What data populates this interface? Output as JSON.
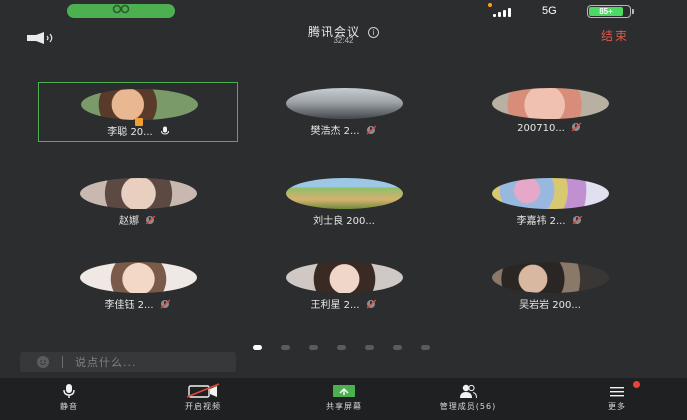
{
  "status_bar": {
    "network": "5G",
    "battery": "85+",
    "battery_level": 0.85
  },
  "header": {
    "title": "腾讯会议",
    "timer": "32:42",
    "end_label": "结束",
    "info_icon": "i"
  },
  "participants": [
    {
      "name": "李聪 20...",
      "mic_icon": "mic-icon"
    },
    {
      "name": "樊浩杰 2...",
      "mic_icon": "mic-muted-icon"
    },
    {
      "name": "200710...",
      "mic_icon": "mic-muted-icon"
    },
    {
      "name": "赵娜",
      "mic_icon": "mic-muted-icon"
    },
    {
      "name": "刘士良 200...",
      "mic_icon": ""
    },
    {
      "name": "李嘉祎 2...",
      "mic_icon": "mic-muted-icon"
    },
    {
      "name": "李佳钰 2...",
      "mic_icon": "mic-muted-icon"
    },
    {
      "name": "王利星 2...",
      "mic_icon": "mic-muted-icon"
    },
    {
      "name": "吴岩岩 200...",
      "mic_icon": ""
    }
  ],
  "pagination": {
    "pages": 7,
    "current": 1
  },
  "chat": {
    "placeholder": "说点什么..."
  },
  "toolbar": {
    "mute_label": "静音",
    "video_label": "开启视频",
    "share_label": "共享屏幕",
    "members_label": "管理成员(56)",
    "more_label": "更多"
  },
  "colors": {
    "background": "#2b2d2f",
    "toolbar": "#1f2022",
    "accent_green": "#4caf50",
    "end_red": "#e65548"
  }
}
